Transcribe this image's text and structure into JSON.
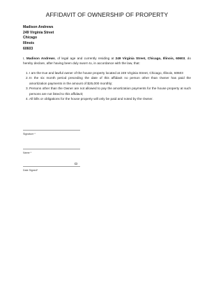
{
  "document": {
    "title": "AFFIDAVIT OF OWNERSHIP OF PROPERTY",
    "address_lines": [
      "Madison Andrews",
      "249 Virginia Street",
      "Chicago",
      "Illinois",
      "60603"
    ],
    "intro": {
      "prefix": "I, ",
      "name": "Madison Andrews",
      "middle": ", of legal age and currently residing at ",
      "address": "249 Virginia Street, Chicago, Illinois, 60603",
      "suffix": ", do hereby declare, after having been duly sworn to, in accordance with the law, that:"
    },
    "clauses": [
      {
        "number": "1.",
        "text": "I am the true and lawful owner of the house property located at 249 Virginia Street, Chicago, Illinois, 60603"
      },
      {
        "number": "2.",
        "text": "In the six month period preceding the date of this affidavit no person other than Owner has paid the amortization payments in the amount of $25,000 monthly;"
      },
      {
        "number": "3.",
        "text": "Persons other than the Owner are not allowed to pay the amortization payments for the house property at such persons are not listed to this affidavit;"
      },
      {
        "number": "4.",
        "text": "All bills or obligations for the house property will only be paid and noted by the Owner."
      }
    ]
  },
  "form": {
    "signature_label": "Signature *",
    "name_label": "Name *",
    "date_label": "Date Signed*",
    "date_icon": "calendar-icon"
  }
}
